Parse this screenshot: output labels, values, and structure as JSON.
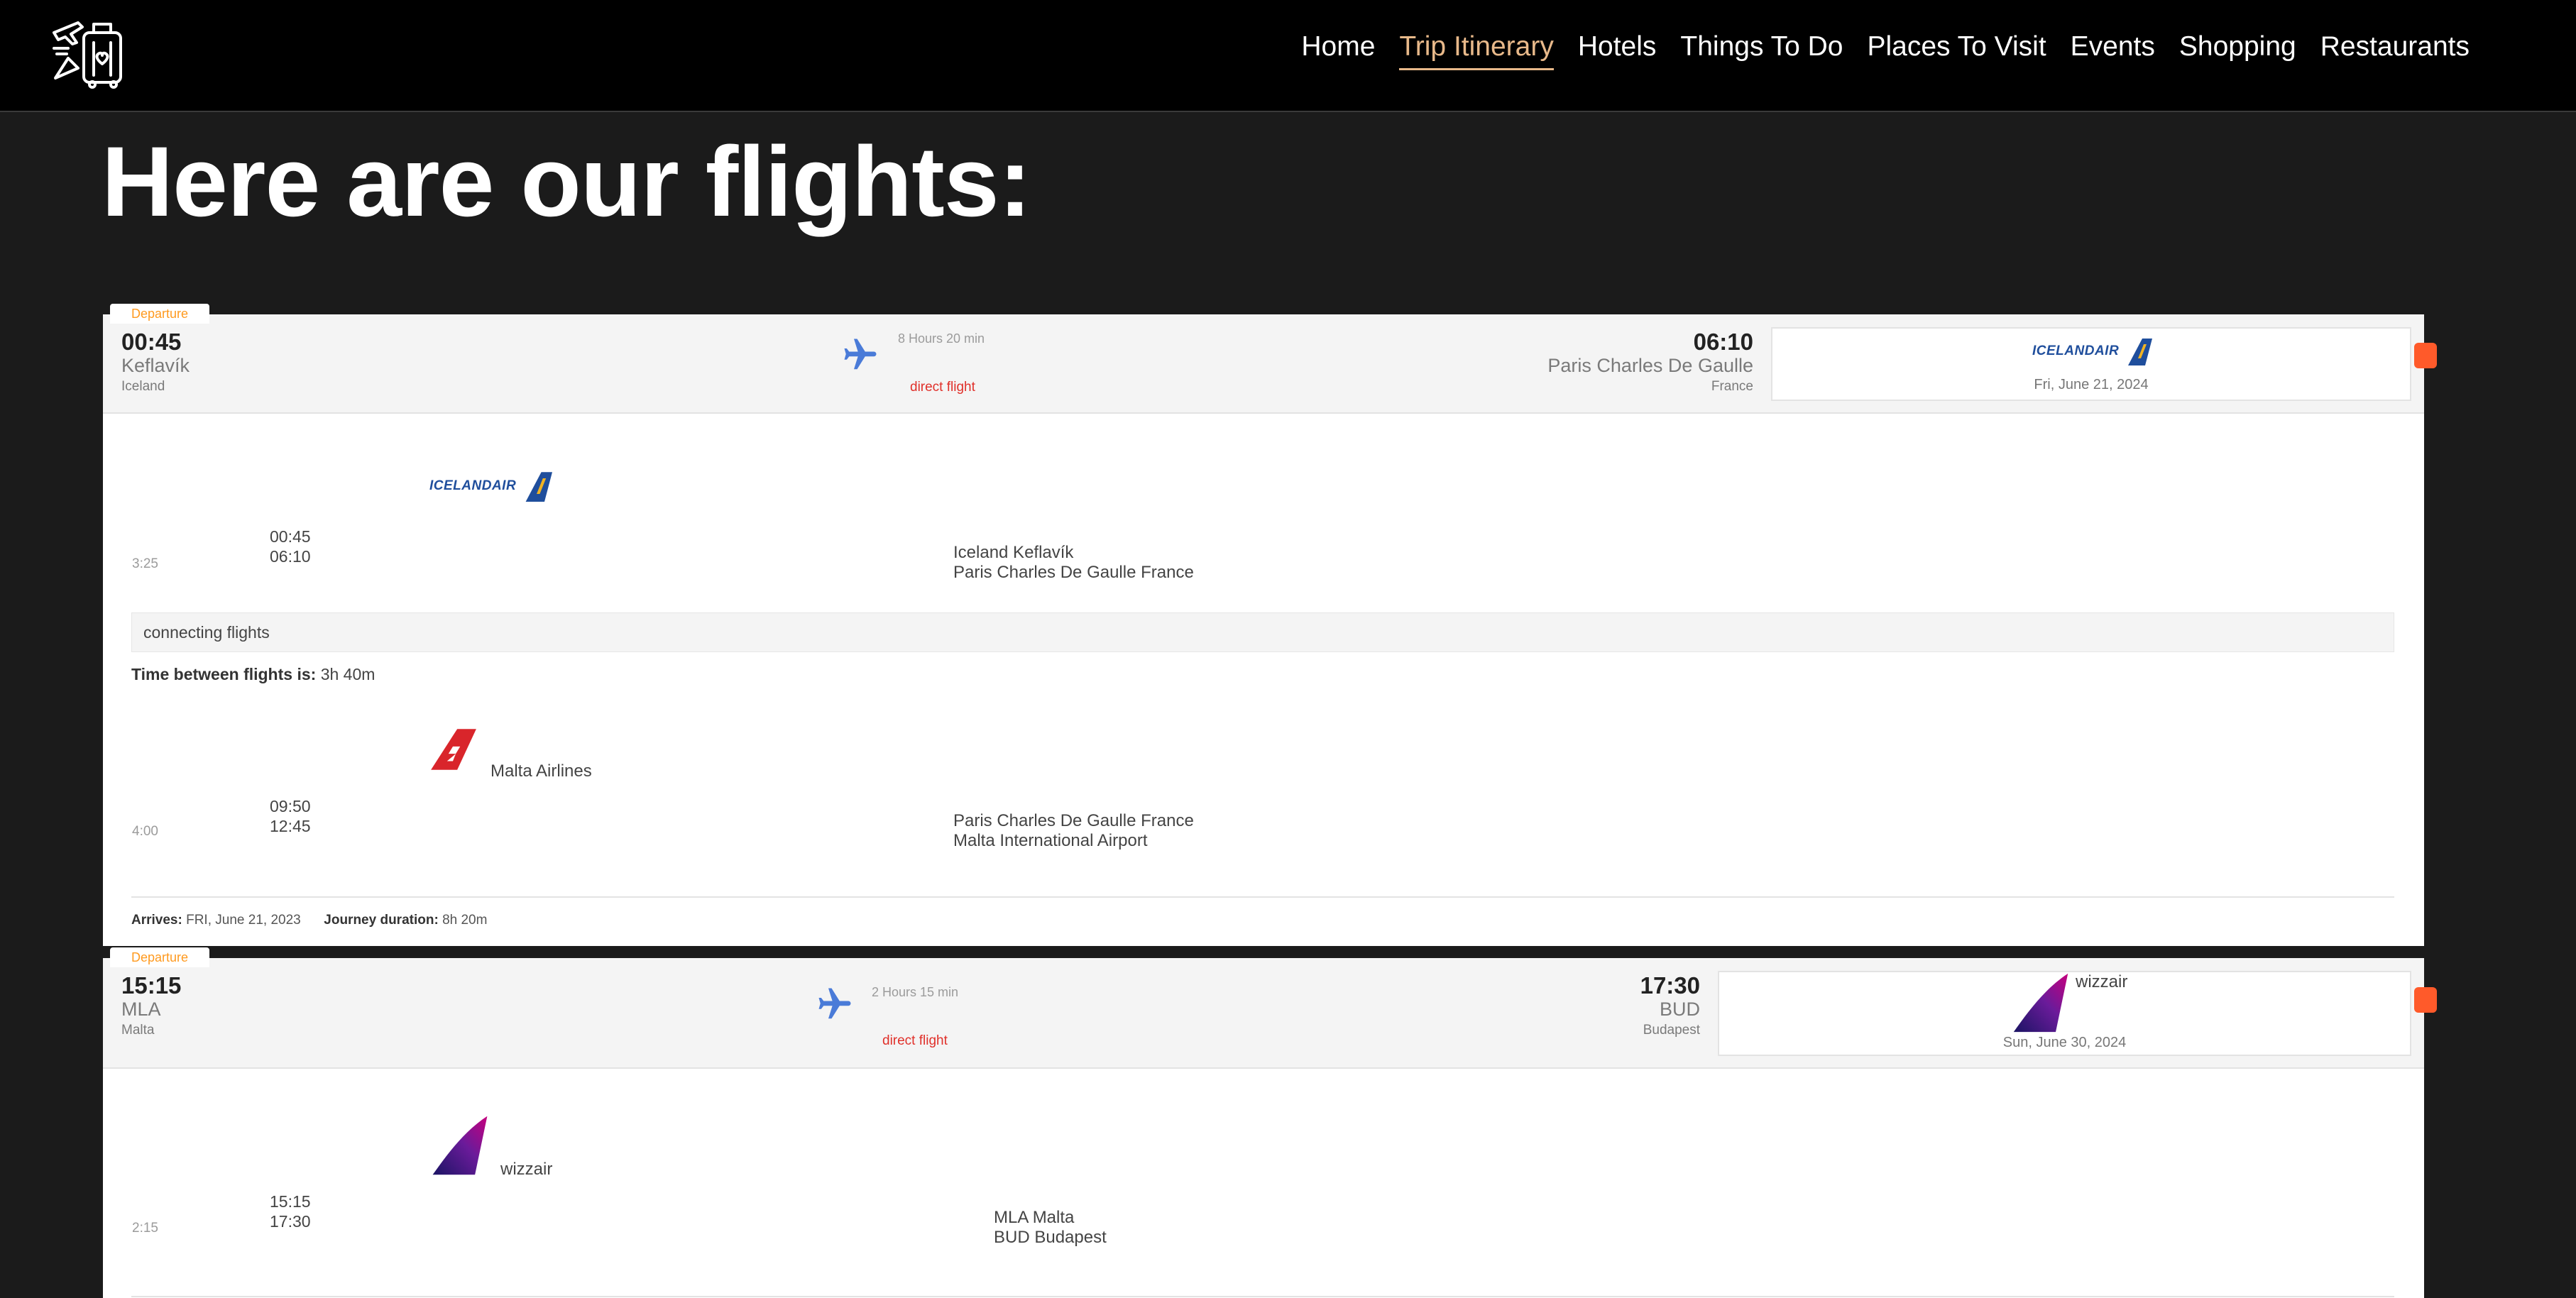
{
  "nav": {
    "items": [
      {
        "label": "Home",
        "active": false
      },
      {
        "label": "Trip Itinerary",
        "active": true
      },
      {
        "label": "Hotels",
        "active": false
      },
      {
        "label": "Things To Do",
        "active": false
      },
      {
        "label": "Places To Visit",
        "active": false
      },
      {
        "label": "Events",
        "active": false
      },
      {
        "label": "Shopping",
        "active": false
      },
      {
        "label": "Restaurants",
        "active": false
      }
    ],
    "accent": "#e8b98a"
  },
  "page_title": "Here are our flights:",
  "flights": [
    {
      "tab": "Departure",
      "dep_time": "00:45",
      "dep_city": "Keflavík",
      "dep_country": "Iceland",
      "duration": "8 Hours 20 min",
      "direct": "direct flight",
      "arr_time": "06:10",
      "arr_city": "Paris Charles De Gaulle",
      "arr_country": "France",
      "airline_logo_text": "ICELANDAIR",
      "date": "Fri, June 21, 2024",
      "legs": [
        {
          "airline_logo": "ICELANDAIR",
          "dep": "00:45",
          "arr": "06:10",
          "dur": "3:25",
          "from": "Iceland Keflavík",
          "to": "Paris Charles De Gaulle France"
        },
        {
          "airline_name": "Malta Airlines",
          "dep": "09:50",
          "arr": "12:45",
          "dur": "4:00",
          "from": "Paris Charles De Gaulle France",
          "to": "Malta International Airport"
        }
      ],
      "connecting_label": "connecting flights",
      "between_label": "Time between flights is:",
      "between_value": "3h 40m",
      "arrives_label": "Arrives:",
      "arrives_value": "FRI, June 21, 2023",
      "journey_label": "Journey duration:",
      "journey_value": "8h 20m"
    },
    {
      "tab": "Departure",
      "dep_time": "15:15",
      "dep_city": "MLA",
      "dep_country": "Malta",
      "duration": "2 Hours 15 min",
      "direct": "direct flight",
      "arr_time": "17:30",
      "arr_city": "BUD",
      "arr_country": "Budapest",
      "airline_name": "wizzair",
      "date": "Sun, June 30, 2024",
      "legs": [
        {
          "airline_name": "wizzair",
          "dep": "15:15",
          "arr": "17:30",
          "dur": "2:15",
          "from": "MLA Malta",
          "to": "BUD Budapest"
        }
      ]
    }
  ],
  "colors": {
    "background": "#1b1b1b",
    "navbar": "#000000",
    "departure_tab": "#ff9a1f",
    "direct_flight": "#e0302a",
    "plane_icon": "#4a7bd8",
    "status_dot": "#ff5a2a",
    "icelandair_blue": "#1f4e9c",
    "icelandair_gold": "#f0b323",
    "malta_red": "#d9252b",
    "wizz_magenta": "#c6007e",
    "wizz_navy": "#1b1464"
  }
}
